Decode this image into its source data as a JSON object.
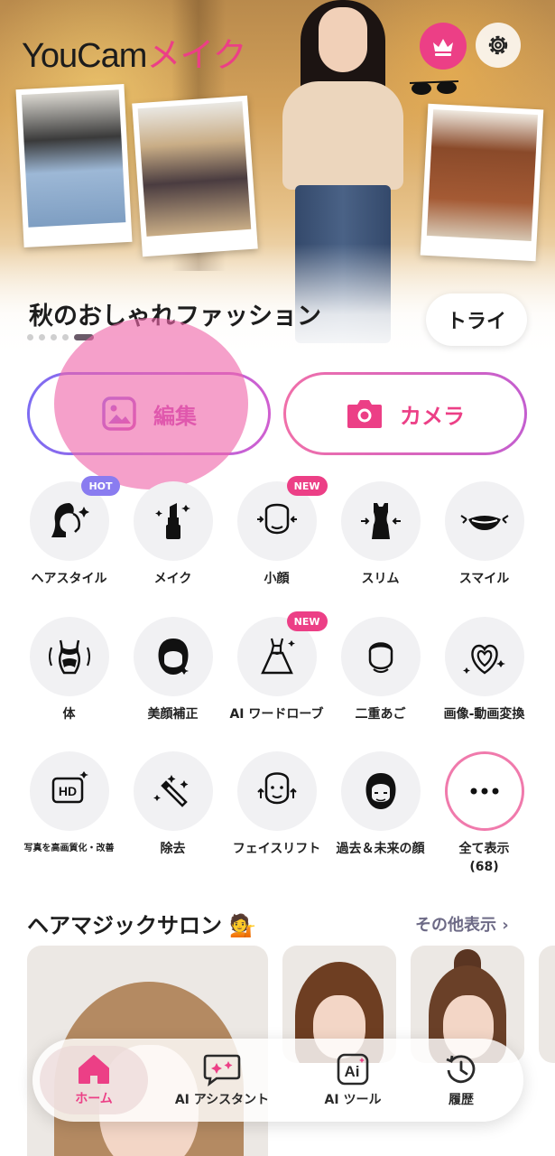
{
  "app": {
    "logo_part1": "YouCam",
    "logo_part2": "メイク",
    "brand_color": "#ec3f86"
  },
  "hero": {
    "title": "秋のおしゃれファッション",
    "try_label": "トライ",
    "page_count": 5,
    "active_page": 5
  },
  "actions": {
    "edit_label": "編集",
    "camera_label": "カメラ"
  },
  "features": [
    {
      "label": "ヘアスタイル",
      "icon": "hair-icon",
      "badge": "HOT"
    },
    {
      "label": "メイク",
      "icon": "lipstick-icon"
    },
    {
      "label": "小顔",
      "icon": "face-slim-icon",
      "badge": "NEW"
    },
    {
      "label": "スリム",
      "icon": "body-slim-icon"
    },
    {
      "label": "スマイル",
      "icon": "smile-icon"
    },
    {
      "label": "体",
      "icon": "body-icon"
    },
    {
      "label": "美顔補正",
      "icon": "beautify-icon"
    },
    {
      "label": "AI ワードローブ",
      "icon": "dress-icon",
      "badge": "NEW"
    },
    {
      "label": "二重あご",
      "icon": "double-chin-icon"
    },
    {
      "label": "画像-動画変換",
      "icon": "photo-to-video-icon"
    },
    {
      "label": "写真を高画質化・改善",
      "icon": "hd-icon"
    },
    {
      "label": "除去",
      "icon": "magic-wand-icon"
    },
    {
      "label": "フェイスリフト",
      "icon": "face-lift-icon"
    },
    {
      "label": "過去＆未来の顔",
      "icon": "aging-face-icon"
    },
    {
      "label": "全て表示",
      "sublabel": "(68)",
      "icon": "more-icon"
    }
  ],
  "salon": {
    "title": "ヘアマジックサロン",
    "emoji": "💁",
    "see_more": "その他表示 ›"
  },
  "nav": {
    "home": "ホーム",
    "ai_assistant": "AI アシスタント",
    "ai_tools": "AI ツール",
    "history": "履歴"
  }
}
